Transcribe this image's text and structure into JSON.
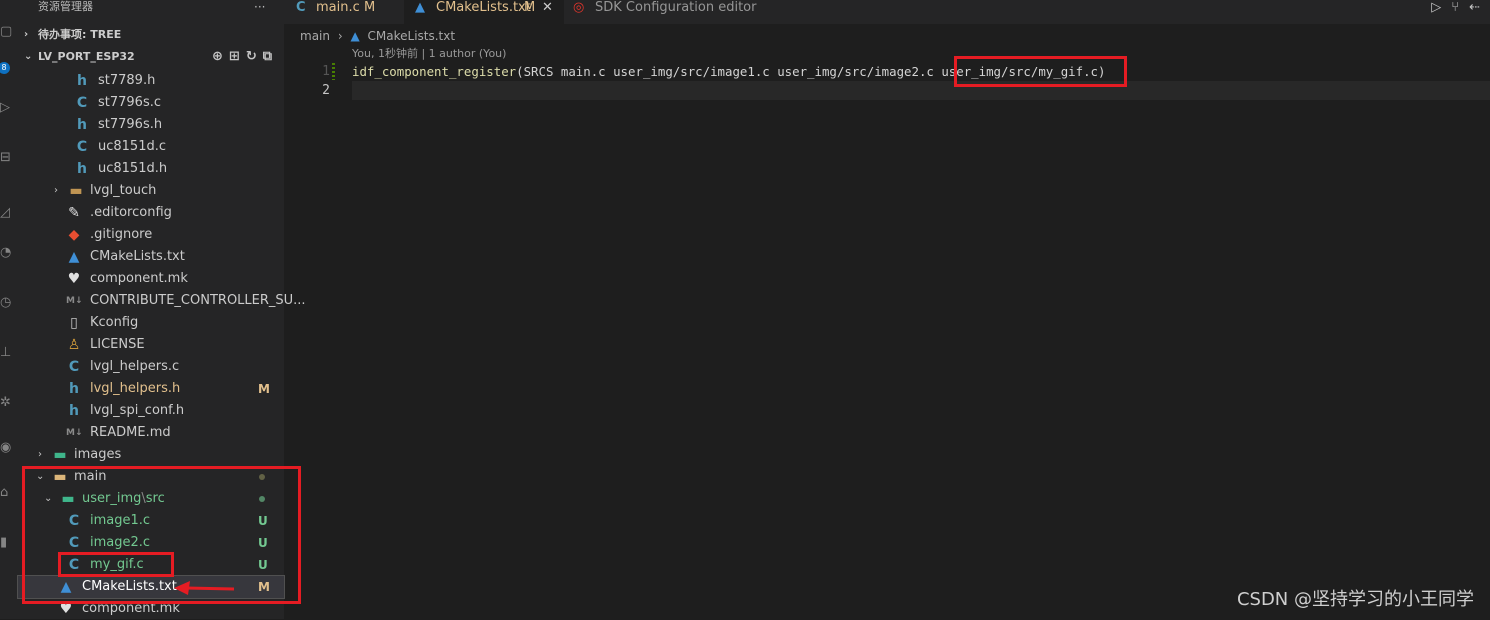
{
  "explorer": {
    "title": "资源管理器",
    "more": "···",
    "todo_section": "待办事项: TREE",
    "project_section": "LV_PORT_ESP32",
    "section_actions": "⊕⊞↻⧉",
    "badge": "8",
    "items": [
      {
        "name": "st7789.h",
        "icon": "h",
        "status": ""
      },
      {
        "name": "st7796s.c",
        "icon": "C",
        "status": ""
      },
      {
        "name": "st7796s.h",
        "icon": "h",
        "status": ""
      },
      {
        "name": "uc8151d.c",
        "icon": "C",
        "status": ""
      },
      {
        "name": "uc8151d.h",
        "icon": "h",
        "status": ""
      },
      {
        "name": "lvgl_touch",
        "icon": "folder",
        "status": ""
      },
      {
        "name": ".editorconfig",
        "icon": "editorconfig",
        "status": ""
      },
      {
        "name": ".gitignore",
        "icon": "git",
        "status": ""
      },
      {
        "name": "CMakeLists.txt",
        "icon": "cmake",
        "status": ""
      },
      {
        "name": "component.mk",
        "icon": "mk",
        "status": ""
      },
      {
        "name": "CONTRIBUTE_CONTROLLER_SU...",
        "icon": "md",
        "status": ""
      },
      {
        "name": "Kconfig",
        "icon": "file",
        "status": ""
      },
      {
        "name": "LICENSE",
        "icon": "license",
        "status": ""
      },
      {
        "name": "lvgl_helpers.c",
        "icon": "C",
        "status": ""
      },
      {
        "name": "lvgl_helpers.h",
        "icon": "h",
        "status": "M"
      },
      {
        "name": "lvgl_spi_conf.h",
        "icon": "h",
        "status": ""
      },
      {
        "name": "README.md",
        "icon": "md",
        "status": ""
      },
      {
        "name": "images",
        "icon": "folder-images",
        "status": ""
      },
      {
        "name": "main",
        "icon": "folder-open",
        "status": "dot"
      },
      {
        "name": "user_img",
        "sep": "\\",
        "name2": "src",
        "icon": "folder-open",
        "status": "dot"
      },
      {
        "name": "image1.c",
        "icon": "C",
        "status": "U"
      },
      {
        "name": "image2.c",
        "icon": "C",
        "status": "U"
      },
      {
        "name": "my_gif.c",
        "icon": "C",
        "status": "U"
      },
      {
        "name": "CMakeLists.txt",
        "icon": "cmake",
        "status": "M"
      },
      {
        "name": "component.mk",
        "icon": "mk",
        "status": ""
      }
    ]
  },
  "tabs": [
    {
      "label": "main.c",
      "status": "M",
      "icon": "C"
    },
    {
      "label": "CMakeLists.txt",
      "status": "M",
      "icon": "cmake",
      "close": "✕"
    },
    {
      "label": "SDK Configuration editor",
      "icon": "espressif"
    }
  ],
  "toolbar": {
    "run": "▷",
    "split": "⑂",
    "more": "⇠"
  },
  "breadcrumb": {
    "folder": "main",
    "sep": "›",
    "file": "CMakeLists.txt"
  },
  "codelens": "You, 1秒钟前 | 1 author (You)",
  "editor": {
    "line_numbers": [
      "1",
      "2"
    ],
    "line1_fn": "idf_component_register",
    "line1_args": "(SRCS main.c user_img/src/image1.c user_img/src/image2.c ",
    "line1_highlight": "user_img/src/my_gif.c",
    "line1_end": ")"
  },
  "watermark": "CSDN @坚持学习的小王同学",
  "colors": {
    "accent_modified": "#e2c08d",
    "accent_untracked": "#73c991",
    "annotation_red": "#e51c23"
  }
}
